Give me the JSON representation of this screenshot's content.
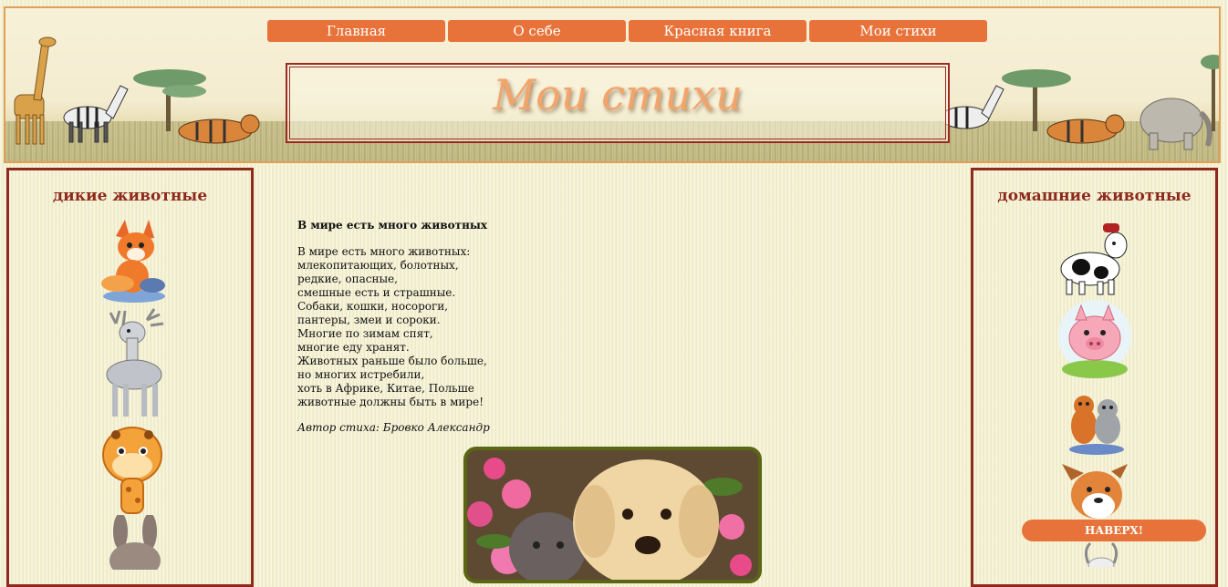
{
  "nav": {
    "items": [
      "Главная",
      "О себе",
      "Красная книга",
      "Мои стихи"
    ]
  },
  "header": {
    "title": "Мои стихи"
  },
  "left_sidebar": {
    "title": "дикие животные",
    "images": [
      "fox-cartoon",
      "deer-cartoon",
      "giraffe-cartoon",
      "rabbit-cartoon"
    ]
  },
  "right_sidebar": {
    "title": "домашние животные",
    "images": [
      "cow-cartoon",
      "pig-cartoon",
      "cats-cartoon",
      "dog-cartoon",
      "goat-cartoon"
    ]
  },
  "poem": {
    "title": "В мире есть много животных",
    "lines": [
      "В мире есть много животных:",
      "млекопитающих, болотных,",
      "редкие, опасные,",
      "смешные есть и страшные.",
      "Собаки, кошки, носороги,",
      "пантеры, змеи и сороки.",
      "Многие по зимам спят,",
      "многие еду хранят.",
      "Животных раньше было больше,",
      "но многих истребили,",
      "хоть в Африке, Китае, Польше",
      "животные должны быть в мире!"
    ],
    "author": "Автор стиха: Бровко Александр"
  },
  "photo": {
    "subject": "puppy-and-kitten-photo"
  },
  "back_to_top": {
    "label": "НАВЕРХ!"
  },
  "colors": {
    "accent": "#e8733a",
    "border": "#8e2a1d",
    "background": "#f3f0cf",
    "title": "#f2a46a"
  }
}
